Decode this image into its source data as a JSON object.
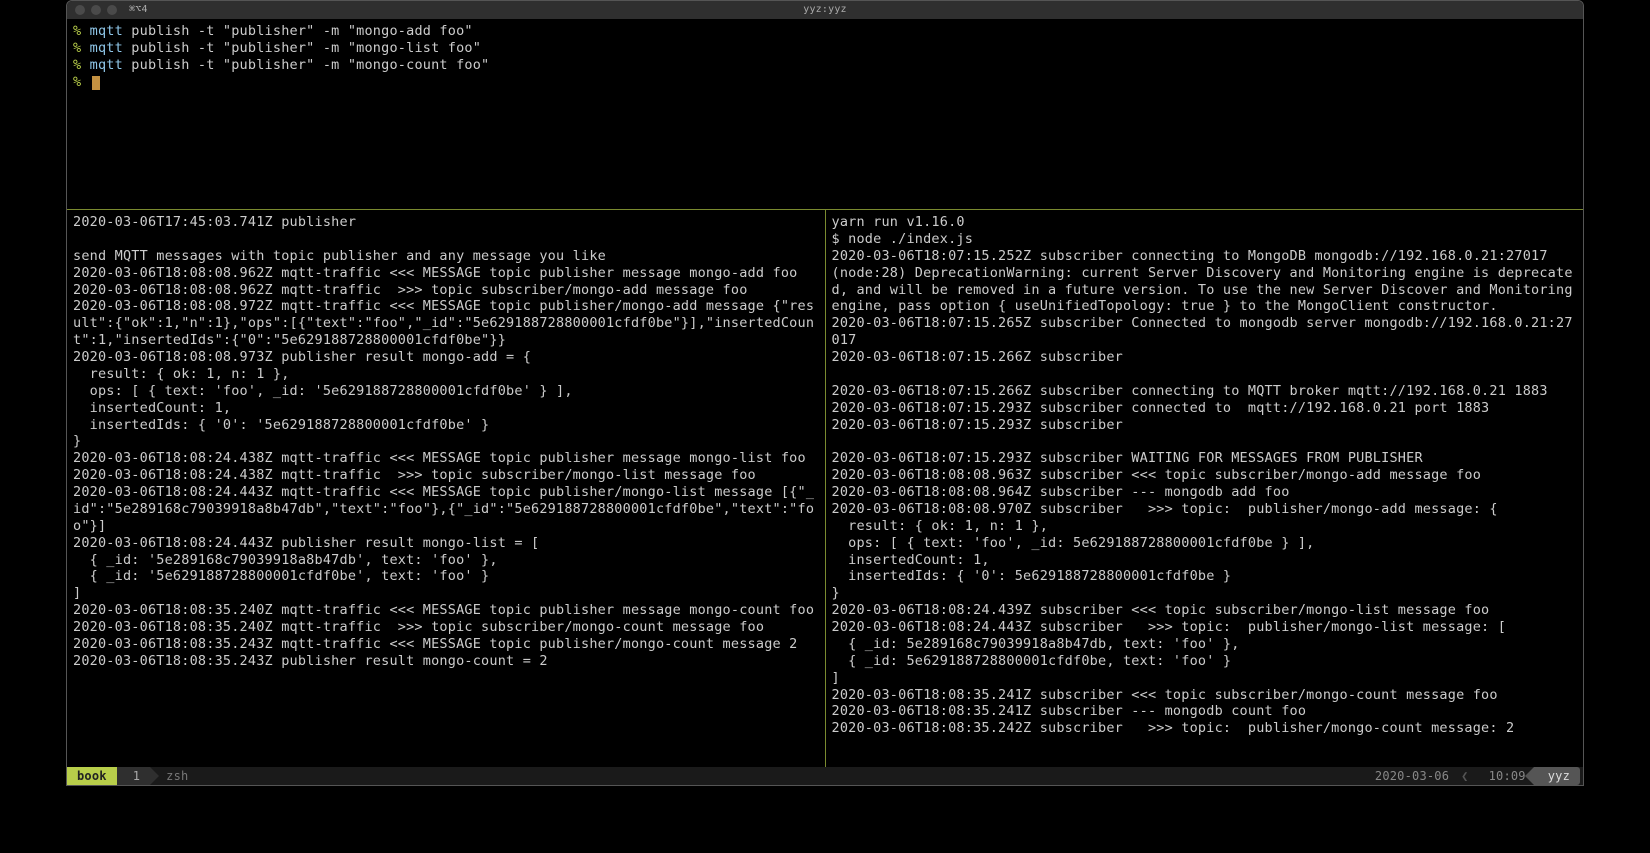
{
  "titlebar": {
    "left": "⌘⌥4",
    "center": "yyz:yyz"
  },
  "top_pane": {
    "lines": [
      {
        "prompt": "%",
        "kw": "mqtt",
        "rest": " publish -t \"publisher\" -m \"mongo-add foo\""
      },
      {
        "prompt": "%",
        "kw": "mqtt",
        "rest": " publish -t \"publisher\" -m \"mongo-list foo\""
      },
      {
        "prompt": "%",
        "kw": "mqtt",
        "rest": " publish -t \"publisher\" -m \"mongo-count foo\""
      },
      {
        "prompt": "%",
        "cursor": true
      }
    ]
  },
  "left_pane": [
    "2020-03-06T17:45:03.741Z publisher",
    "",
    "send MQTT messages with topic publisher and any message you like",
    "2020-03-06T18:08:08.962Z mqtt-traffic <<< MESSAGE topic publisher message mongo-add foo",
    "2020-03-06T18:08:08.962Z mqtt-traffic  >>> topic subscriber/mongo-add message foo",
    "2020-03-06T18:08:08.972Z mqtt-traffic <<< MESSAGE topic publisher/mongo-add message {\"result\":{\"ok\":1,\"n\":1},\"ops\":[{\"text\":\"foo\",\"_id\":\"5e629188728800001cfdf0be\"}],\"insertedCount\":1,\"insertedIds\":{\"0\":\"5e629188728800001cfdf0be\"}}",
    "2020-03-06T18:08:08.973Z publisher result mongo-add = {",
    "  result: { ok: 1, n: 1 },",
    "  ops: [ { text: 'foo', _id: '5e629188728800001cfdf0be' } ],",
    "  insertedCount: 1,",
    "  insertedIds: { '0': '5e629188728800001cfdf0be' }",
    "}",
    "2020-03-06T18:08:24.438Z mqtt-traffic <<< MESSAGE topic publisher message mongo-list foo",
    "2020-03-06T18:08:24.438Z mqtt-traffic  >>> topic subscriber/mongo-list message foo",
    "2020-03-06T18:08:24.443Z mqtt-traffic <<< MESSAGE topic publisher/mongo-list message [{\"_id\":\"5e289168c79039918a8b47db\",\"text\":\"foo\"},{\"_id\":\"5e629188728800001cfdf0be\",\"text\":\"foo\"}]",
    "2020-03-06T18:08:24.443Z publisher result mongo-list = [",
    "  { _id: '5e289168c79039918a8b47db', text: 'foo' },",
    "  { _id: '5e629188728800001cfdf0be', text: 'foo' }",
    "]",
    "2020-03-06T18:08:35.240Z mqtt-traffic <<< MESSAGE topic publisher message mongo-count foo",
    "2020-03-06T18:08:35.240Z mqtt-traffic  >>> topic subscriber/mongo-count message foo",
    "2020-03-06T18:08:35.243Z mqtt-traffic <<< MESSAGE topic publisher/mongo-count message 2",
    "2020-03-06T18:08:35.243Z publisher result mongo-count = 2"
  ],
  "right_pane": [
    "yarn run v1.16.0",
    "$ node ./index.js",
    "2020-03-06T18:07:15.252Z subscriber connecting to MongoDB mongodb://192.168.0.21:27017",
    "(node:28) DeprecationWarning: current Server Discovery and Monitoring engine is deprecated, and will be removed in a future version. To use the new Server Discover and Monitoring engine, pass option { useUnifiedTopology: true } to the MongoClient constructor.",
    "2020-03-06T18:07:15.265Z subscriber Connected to mongodb server mongodb://192.168.0.21:27017",
    "2020-03-06T18:07:15.266Z subscriber",
    "",
    "2020-03-06T18:07:15.266Z subscriber connecting to MQTT broker mqtt://192.168.0.21 1883",
    "2020-03-06T18:07:15.293Z subscriber connected to  mqtt://192.168.0.21 port 1883",
    "2020-03-06T18:07:15.293Z subscriber",
    "",
    "2020-03-06T18:07:15.293Z subscriber WAITING FOR MESSAGES FROM PUBLISHER",
    "2020-03-06T18:08:08.963Z subscriber <<< topic subscriber/mongo-add message foo",
    "2020-03-06T18:08:08.964Z subscriber --- mongodb add foo",
    "2020-03-06T18:08:08.970Z subscriber   >>> topic:  publisher/mongo-add message: {",
    "  result: { ok: 1, n: 1 },",
    "  ops: [ { text: 'foo', _id: 5e629188728800001cfdf0be } ],",
    "  insertedCount: 1,",
    "  insertedIds: { '0': 5e629188728800001cfdf0be }",
    "}",
    "2020-03-06T18:08:24.439Z subscriber <<< topic subscriber/mongo-list message foo",
    "2020-03-06T18:08:24.443Z subscriber   >>> topic:  publisher/mongo-list message: [",
    "  { _id: 5e289168c79039918a8b47db, text: 'foo' },",
    "  { _id: 5e629188728800001cfdf0be, text: 'foo' }",
    "]",
    "2020-03-06T18:08:35.241Z subscriber <<< topic subscriber/mongo-count message foo",
    "2020-03-06T18:08:35.241Z subscriber --- mongodb count foo",
    "2020-03-06T18:08:35.242Z subscriber   >>> topic:  publisher/mongo-count message: 2"
  ],
  "statusbar": {
    "host": "book",
    "index": "1",
    "shell": "zsh",
    "date": "2020-03-06",
    "time": "10:09",
    "remote": "yyz"
  }
}
